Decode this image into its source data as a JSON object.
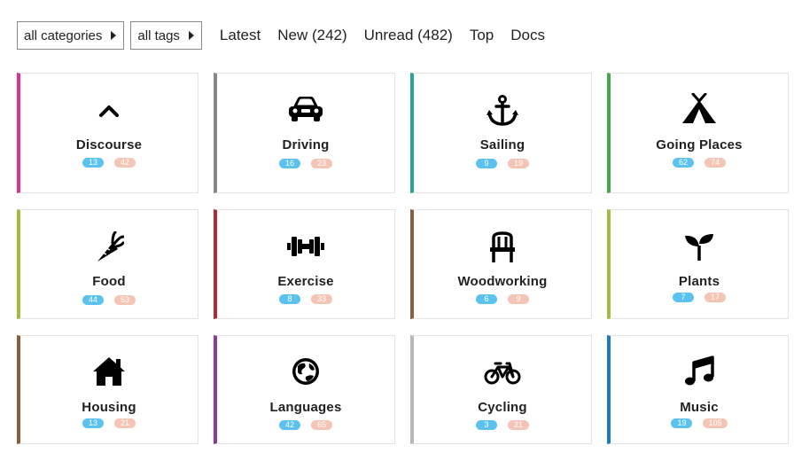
{
  "nav": {
    "categories_dropdown": "all categories",
    "tags_dropdown": "all tags",
    "links": {
      "latest": "Latest",
      "new": "New (242)",
      "unread": "Unread (482)",
      "top": "Top",
      "docs": "Docs"
    }
  },
  "colors": {
    "new_badge": "#5bc2f0",
    "unread_badge": "#f4c4b5",
    "discourse": "#e2318a",
    "driving": "#878787",
    "sailing": "#26a69a",
    "going_places": "#44a84a",
    "food": "#a7b840",
    "exercise": "#b32a36",
    "woodworking": "#8a5d3b",
    "plants": "#a7b840",
    "housing": "#8a5d3b",
    "languages": "#8e3a9d",
    "cycling": "#b7b7b7",
    "music": "#1a7ac2"
  },
  "categories": [
    {
      "name": "Discourse",
      "icon": "chevron-up-icon",
      "new": "13",
      "unread": "42"
    },
    {
      "name": "Driving",
      "icon": "car-icon",
      "new": "16",
      "unread": "23"
    },
    {
      "name": "Sailing",
      "icon": "anchor-icon",
      "new": "9",
      "unread": "19"
    },
    {
      "name": "Going Places",
      "icon": "tent-icon",
      "new": "62",
      "unread": "74"
    },
    {
      "name": "Food",
      "icon": "carrot-icon",
      "new": "44",
      "unread": "53"
    },
    {
      "name": "Exercise",
      "icon": "dumbbell-icon",
      "new": "8",
      "unread": "33"
    },
    {
      "name": "Woodworking",
      "icon": "chair-icon",
      "new": "6",
      "unread": "9"
    },
    {
      "name": "Plants",
      "icon": "seedling-icon",
      "new": "7",
      "unread": "17"
    },
    {
      "name": "Housing",
      "icon": "house-icon",
      "new": "13",
      "unread": "21"
    },
    {
      "name": "Languages",
      "icon": "globe-icon",
      "new": "42",
      "unread": "65"
    },
    {
      "name": "Cycling",
      "icon": "bicycle-icon",
      "new": "3",
      "unread": "21"
    },
    {
      "name": "Music",
      "icon": "music-icon",
      "new": "19",
      "unread": "105"
    }
  ]
}
